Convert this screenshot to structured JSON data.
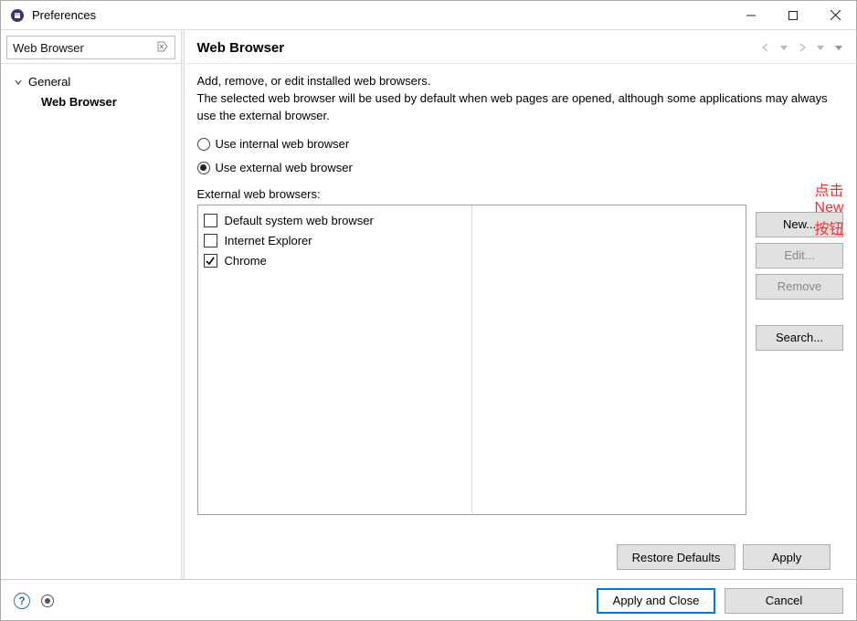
{
  "window": {
    "title": "Preferences"
  },
  "filter": {
    "text": "Web Browser"
  },
  "tree": {
    "root_label": "General",
    "child_label": "Web Browser"
  },
  "page": {
    "title": "Web Browser",
    "desc1": "Add, remove, or edit installed web browsers.",
    "desc2": "The selected web browser will be used by default when web pages are opened, although some applications may always use the external browser.",
    "radio_internal": "Use internal web browser",
    "radio_external": "Use external web browser",
    "radio_selected": "external",
    "list_label": "External web browsers:",
    "browsers": [
      {
        "label": "Default system web browser",
        "checked": false
      },
      {
        "label": "Internet Explorer",
        "checked": false
      },
      {
        "label": "Chrome",
        "checked": true
      }
    ],
    "buttons": {
      "new": "New...",
      "edit": "Edit...",
      "remove": "Remove",
      "search": "Search...",
      "restore": "Restore Defaults",
      "apply": "Apply"
    }
  },
  "bottom": {
    "apply_close": "Apply and Close",
    "cancel": "Cancel"
  },
  "annotation": {
    "text": "点击New按钮"
  }
}
